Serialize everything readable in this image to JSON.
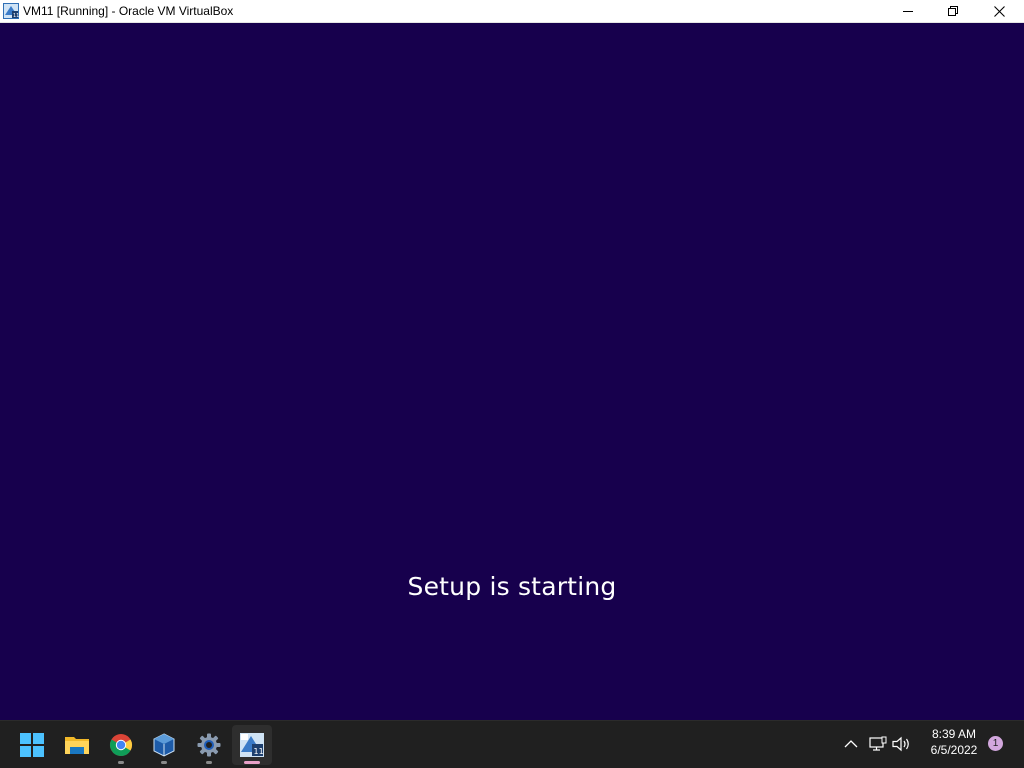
{
  "window": {
    "title": "VM11 [Running] - Oracle VM VirtualBox",
    "icon": "virtualbox-vm-icon",
    "buttons": {
      "minimize": "minimize-icon",
      "maximize": "restore-icon",
      "close": "close-icon"
    }
  },
  "guest": {
    "status_text": "Setup is starting",
    "background_color": "#17004d"
  },
  "taskbar": {
    "apps": [
      {
        "name": "Start",
        "icon": "windows-start-icon"
      },
      {
        "name": "File Explorer",
        "icon": "folder-icon"
      },
      {
        "name": "Google Chrome",
        "icon": "chrome-icon"
      },
      {
        "name": "Oracle VM VirtualBox Manager",
        "icon": "virtualbox-icon"
      },
      {
        "name": "Settings",
        "icon": "gear-icon"
      },
      {
        "name": "VM11",
        "icon": "virtualbox-vm-icon",
        "active": true
      }
    ],
    "tray": {
      "icons": [
        "chevron-up-icon",
        "network-icon",
        "volume-icon"
      ]
    },
    "clock": {
      "time": "8:39 AM",
      "date": "6/5/2022"
    },
    "notification_count": "1"
  },
  "colors": {
    "taskbar_bg": "#202020",
    "accent_indicator": "#e8a0c8",
    "badge": "#d2a7dd"
  }
}
